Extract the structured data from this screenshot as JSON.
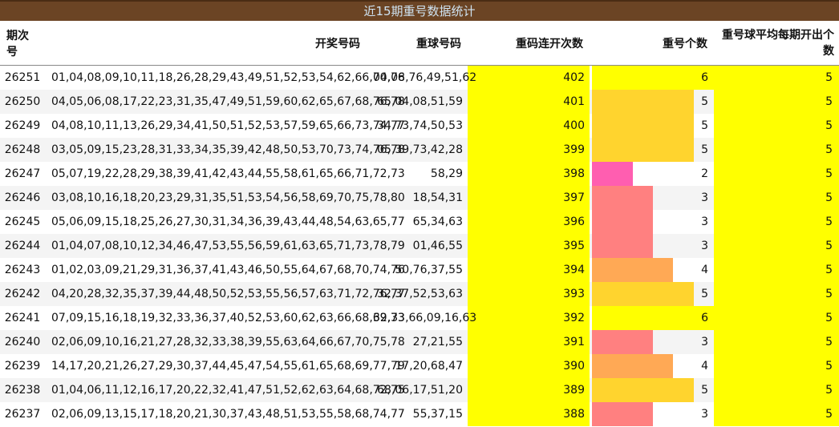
{
  "title": "近15期重号数据统计",
  "headers": {
    "period": "期次号",
    "winning": "开奖号码",
    "repeat_balls": "重球号码",
    "streak": "重码连开次数",
    "repeat_count": "重号个数",
    "avg": "重号球平均每期开出个数"
  },
  "count_max": 6,
  "count_colors": {
    "2": "#ff5eb0",
    "3": "#ff8080",
    "4": "#ffa955",
    "5": "#ffd42e",
    "6": "#ffff00"
  },
  "rows": [
    {
      "period": "26251",
      "winning": "01,04,08,09,10,11,18,26,28,29,43,49,51,52,53,54,62,66,70,76",
      "repeat_balls": "04,08,76,49,51,62",
      "streak": "402",
      "count": 6,
      "avg": "5"
    },
    {
      "period": "26250",
      "winning": "04,05,06,08,17,22,23,31,35,47,49,51,59,60,62,65,67,68,76,78",
      "repeat_balls": "65,04,08,51,59",
      "streak": "401",
      "count": 5,
      "avg": "5"
    },
    {
      "period": "26249",
      "winning": "04,08,10,11,13,26,29,34,41,50,51,52,53,57,59,65,66,73,74,77",
      "repeat_balls": "34,73,74,50,53",
      "streak": "400",
      "count": 5,
      "avg": "5"
    },
    {
      "period": "26248",
      "winning": "03,05,09,15,23,28,31,33,34,35,39,42,48,50,53,70,73,74,76,78",
      "repeat_balls": "05,39,73,42,28",
      "streak": "399",
      "count": 5,
      "avg": "5"
    },
    {
      "period": "26247",
      "winning": "05,07,19,22,28,29,38,39,41,42,43,44,55,58,61,65,66,71,72,73",
      "repeat_balls": "58,29",
      "streak": "398",
      "count": 2,
      "avg": "5"
    },
    {
      "period": "26246",
      "winning": "03,08,10,16,18,20,23,29,31,35,51,53,54,56,58,69,70,75,78,80",
      "repeat_balls": "18,54,31",
      "streak": "397",
      "count": 3,
      "avg": "5"
    },
    {
      "period": "26245",
      "winning": "05,06,09,15,18,25,26,27,30,31,34,36,39,43,44,48,54,63,65,77",
      "repeat_balls": "65,34,63",
      "streak": "396",
      "count": 3,
      "avg": "5"
    },
    {
      "period": "26244",
      "winning": "01,04,07,08,10,12,34,46,47,53,55,56,59,61,63,65,71,73,78,79",
      "repeat_balls": "01,46,55",
      "streak": "395",
      "count": 3,
      "avg": "5"
    },
    {
      "period": "26243",
      "winning": "01,02,03,09,21,29,31,36,37,41,43,46,50,55,64,67,68,70,74,76",
      "repeat_balls": "50,76,37,55",
      "streak": "394",
      "count": 4,
      "avg": "5"
    },
    {
      "period": "26242",
      "winning": "04,20,28,32,35,37,39,44,48,50,52,53,55,56,57,63,71,72,76,77",
      "repeat_balls": "32,37,52,53,63",
      "streak": "393",
      "count": 5,
      "avg": "5"
    },
    {
      "period": "26241",
      "winning": "07,09,15,16,18,19,32,33,36,37,40,52,53,60,62,63,66,68,69,73",
      "repeat_balls": "32,33,66,09,16,63",
      "streak": "392",
      "count": 6,
      "avg": "5"
    },
    {
      "period": "26240",
      "winning": "02,06,09,10,16,21,27,28,32,33,38,39,55,63,64,66,67,70,75,78",
      "repeat_balls": "27,21,55",
      "streak": "391",
      "count": 3,
      "avg": "5"
    },
    {
      "period": "26239",
      "winning": "14,17,20,21,26,27,29,30,37,44,45,47,54,55,61,65,68,69,77,79",
      "repeat_balls": "17,20,68,47",
      "streak": "390",
      "count": 4,
      "avg": "5"
    },
    {
      "period": "26238",
      "winning": "01,04,06,11,12,16,17,20,22,32,41,47,51,52,62,63,64,68,72,75",
      "repeat_balls": "68,06,17,51,20",
      "streak": "389",
      "count": 5,
      "avg": "5"
    },
    {
      "period": "26237",
      "winning": "02,06,09,13,15,17,18,20,21,30,37,43,48,51,53,55,58,68,74,77",
      "repeat_balls": "55,37,15",
      "streak": "388",
      "count": 3,
      "avg": "5"
    }
  ]
}
